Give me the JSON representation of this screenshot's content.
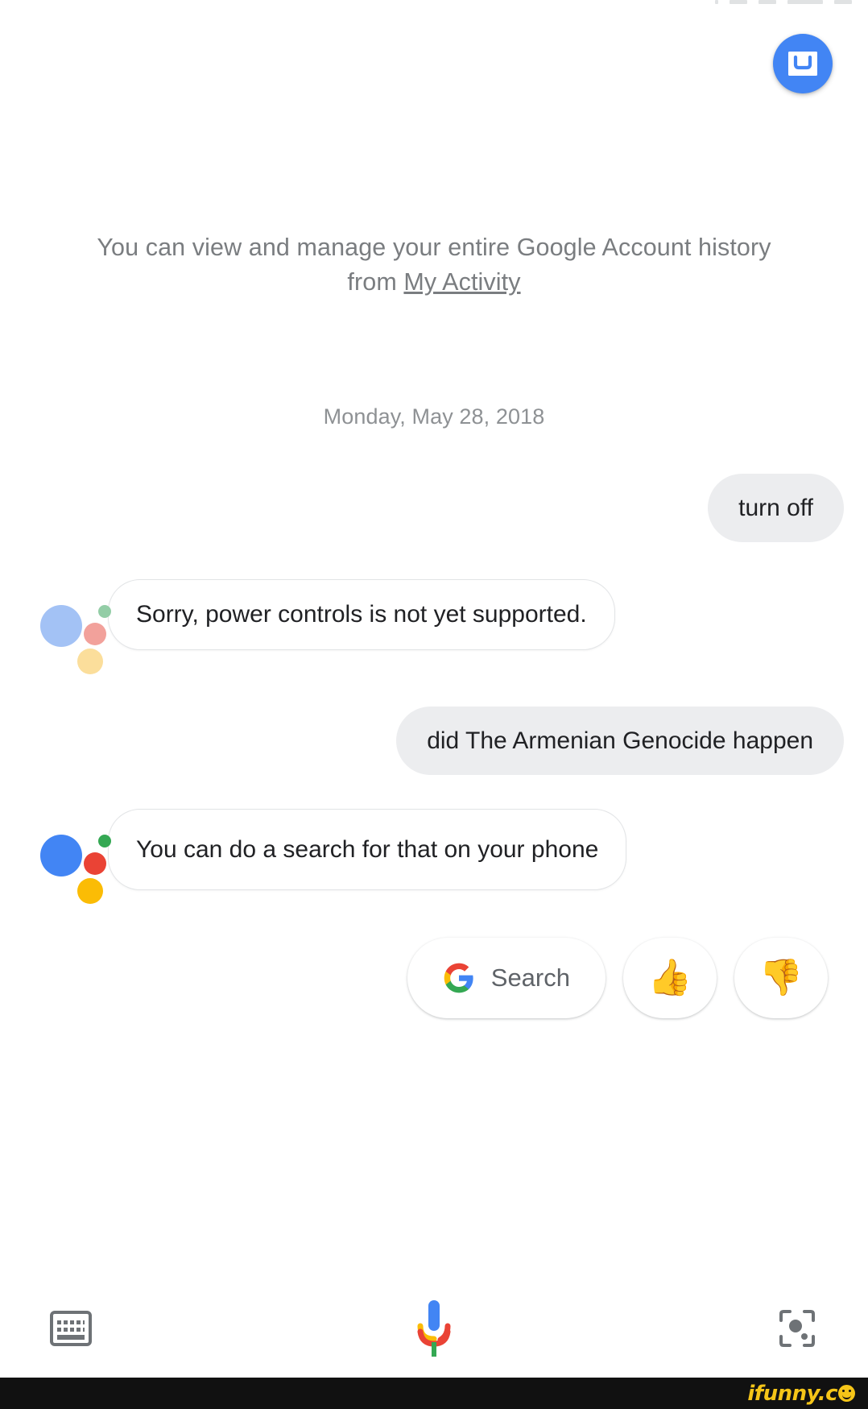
{
  "app": {
    "name": "Google Assistant",
    "background_color": "#ffffff"
  },
  "colors": {
    "google_blue": "#4285F4",
    "google_red": "#EA4335",
    "google_yellow": "#FBBC05",
    "google_green": "#34A853",
    "user_bubble": "#ECEDEF",
    "assistant_bubble_border": "#E2E4E6",
    "muted_text": "#7a7d80",
    "primary_text": "#202124"
  },
  "header": {
    "inbox_button": {
      "icon": "inbox-tray-icon",
      "label": "Inbox"
    }
  },
  "history_note": {
    "text_before_link": "You can view and manage your entire Google Account history from ",
    "link_label": "My Activity"
  },
  "date_divider": {
    "label": "Monday, May 28, 2018"
  },
  "conversation": [
    {
      "role": "user",
      "text": "turn off"
    },
    {
      "role": "assistant",
      "text": "Sorry, power controls is not yet supported.",
      "logo_state": "faded"
    },
    {
      "role": "user",
      "text": "did The Armenian Genocide happen"
    },
    {
      "role": "assistant",
      "text": "You can do a search for that on your phone",
      "logo_state": "full"
    }
  ],
  "suggestion_chips": [
    {
      "id": "search",
      "icon": "google-g-icon",
      "label": "Search"
    },
    {
      "id": "thumbs-up",
      "icon": "thumbs-up-icon",
      "label": "👍"
    },
    {
      "id": "thumbs-down",
      "icon": "thumbs-down-icon",
      "label": "👎"
    }
  ],
  "bottom_bar": {
    "keyboard_button": {
      "icon": "keyboard-icon",
      "label": "Keyboard"
    },
    "mic_button": {
      "icon": "microphone-icon",
      "label": "Voice input"
    },
    "lens_button": {
      "icon": "google-lens-icon",
      "label": "Google Lens"
    }
  },
  "watermark": {
    "text": "ifunny.c",
    "suffix_icon": "smiley-face-icon"
  }
}
